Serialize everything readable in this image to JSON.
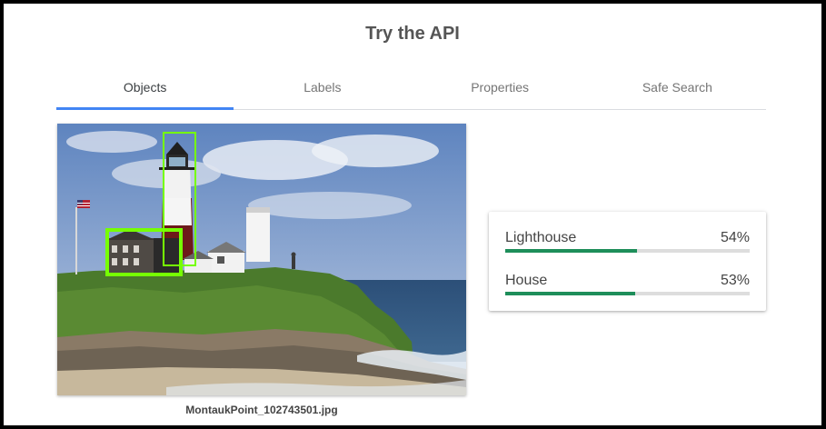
{
  "header": {
    "title": "Try the API"
  },
  "tabs": [
    {
      "label": "Objects",
      "active": true
    },
    {
      "label": "Labels",
      "active": false
    },
    {
      "label": "Properties",
      "active": false
    },
    {
      "label": "Safe Search",
      "active": false
    }
  ],
  "image": {
    "filename": "MontaukPoint_102743501.jpg"
  },
  "results": [
    {
      "name": "Lighthouse",
      "percent_label": "54%",
      "score": 0.54
    },
    {
      "name": "House",
      "percent_label": "53%",
      "score": 0.53
    }
  ],
  "colors": {
    "accent": "#4285f4",
    "bar_fill": "#1e8e5a",
    "bar_track": "#dddddd",
    "bounding_box": "#76ff03"
  }
}
